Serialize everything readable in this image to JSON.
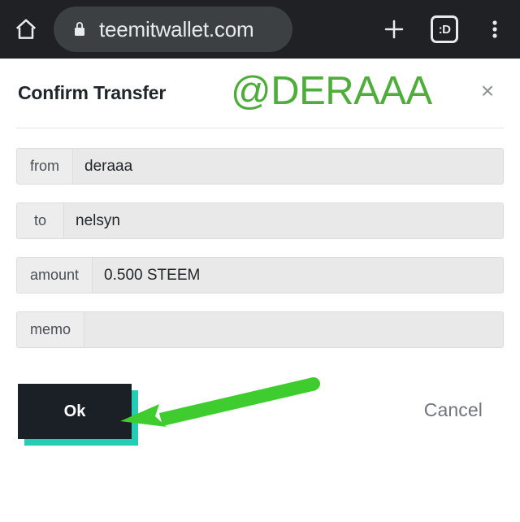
{
  "browser": {
    "home_icon": "home-icon",
    "lock_icon": "lock-icon",
    "url": "teemitwallet.com",
    "new_tab_icon": "plus-icon",
    "tab_counter_label": ":D",
    "menu_icon": "overflow-menu-icon"
  },
  "dialog": {
    "title": "Confirm Transfer",
    "close_label": "×",
    "fields": [
      {
        "label": "from",
        "value": "deraaa"
      },
      {
        "label": "to",
        "value": "nelsyn"
      },
      {
        "label": "amount",
        "value": "0.500 STEEM"
      },
      {
        "label": "memo",
        "value": ""
      }
    ],
    "ok_label": "Ok",
    "cancel_label": "Cancel"
  },
  "annotations": {
    "handle_text": "@DERAAA",
    "handle_color": "#4fae3b",
    "arrow_color": "#3fcc2e",
    "arrow_name": "green-arrow-pointing-to-ok-button"
  },
  "colors": {
    "browser_bar": "#202124",
    "url_pill": "#3c4043",
    "ok_button": "#1b2026",
    "ok_shadow_teal": "#22cdb4",
    "field_bg": "#e9e9e9",
    "page_bg": "#ffffff"
  }
}
